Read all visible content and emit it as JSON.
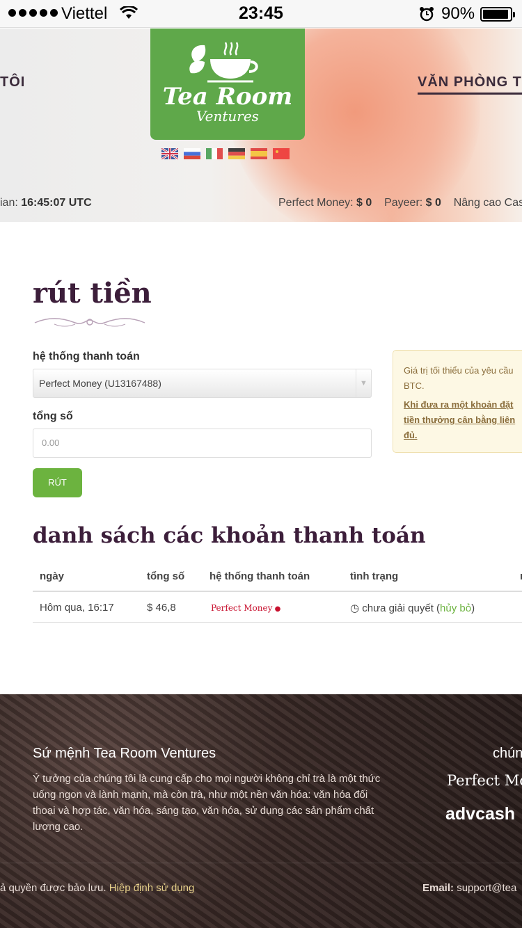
{
  "status_bar": {
    "carrier": "Viettel",
    "time": "23:45",
    "battery": "90%"
  },
  "header": {
    "nav_left": "TÔI",
    "nav_right": "VĂN PHÒNG T",
    "logo_line1": "Tea Room",
    "logo_line2": "Ventures",
    "languages": [
      "english-flag",
      "russian-flag",
      "italian-flag",
      "german-flag",
      "spanish-flag",
      "chinese-flag"
    ],
    "time_label": "ian: ",
    "time_value": "16:45:07 UTC",
    "balances": [
      {
        "label": "Perfect Money: ",
        "value": "$ 0"
      },
      {
        "label": "Payeer: ",
        "value": "$ 0"
      },
      {
        "label": "Nâng cao Cash",
        "value": ""
      }
    ]
  },
  "withdraw": {
    "title": "rút tiền",
    "payment_system_label": "hệ thống thanh toán",
    "payment_system_value": "Perfect Money (U13167488)",
    "amount_label": "tổng số",
    "amount_placeholder": "0.00",
    "submit_label": "RÚT",
    "notice_line1": "Giá trị tối thiểu của yêu cầu",
    "notice_line2": "BTC.",
    "notice_bold1": "Khi đưa ra một khoản đặt",
    "notice_bold2": "tiền thưởng cân bằng liên",
    "notice_bold3": "đủ."
  },
  "payments": {
    "title": "danh sách các khoản thanh toán",
    "columns": [
      "ngày",
      "tổng số",
      "hệ thống thanh toán",
      "tình trạng",
      "n"
    ],
    "rows": [
      {
        "date": "Hôm qua, 16:17",
        "amount": "$ 46,8",
        "system": "Perfect Money",
        "status": "chưa giải quyết (",
        "action": "hủy bỏ",
        "status_end": ")"
      }
    ]
  },
  "footer": {
    "mission_title": "Sứ mệnh Tea Room Ventures",
    "mission_text": "Ý tưởng của chúng tôi là cung cấp cho mọi người không chỉ trà là một thức uống ngon và lành mạnh, mà còn trà, như một nền văn hóa: văn hóa đối thoại và hợp tác, văn hóa, sáng tạo, văn hóa, sử dụng các sản phẩm chất lượng cao.",
    "partners_title": "chúng",
    "partner1": "Perfect Money",
    "partner2": "advcash",
    "copyright": "ả quyền được bảo lưu. ",
    "terms_link": "Hiệp định sử dụng",
    "email_label": "Email: ",
    "email_value": "support@tea"
  },
  "colors": {
    "accent_green": "#6cb33f",
    "logo_green": "#5fa84a",
    "heading_purple": "#3c1e3a",
    "notice_bg": "#fdf8e4"
  }
}
